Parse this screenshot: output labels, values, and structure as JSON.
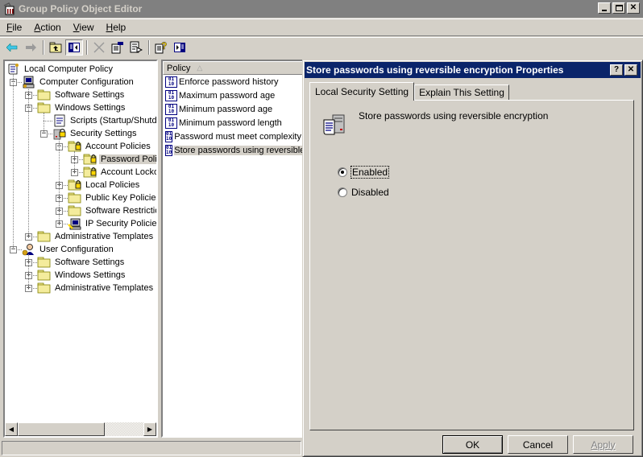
{
  "window": {
    "title": "Group Policy Object Editor",
    "controls": [
      "minimize",
      "maximize",
      "close"
    ]
  },
  "menu": [
    {
      "label": "File",
      "accel": "F"
    },
    {
      "label": "Action",
      "accel": "A"
    },
    {
      "label": "View",
      "accel": "V"
    },
    {
      "label": "Help",
      "accel": "H"
    }
  ],
  "toolbar": [
    "back-icon",
    "forward-icon",
    "up-folder-icon",
    "show-hide-tree-icon",
    "delete-icon",
    "properties-icon",
    "export-list-icon",
    "help-icon",
    "show-hide-action-pane-icon"
  ],
  "tree": {
    "items": [
      {
        "label": "Local Computer Policy",
        "level": 0,
        "icon": "policy-scroll-icon",
        "expander": "none"
      },
      {
        "label": "Computer Configuration",
        "level": 1,
        "icon": "computer-icon",
        "expander": "minus"
      },
      {
        "label": "Software Settings",
        "level": 2,
        "icon": "folder-icon",
        "expander": "plus"
      },
      {
        "label": "Windows Settings",
        "level": 2,
        "icon": "folder-icon",
        "expander": "minus"
      },
      {
        "label": "Scripts (Startup/Shutdown)",
        "level": 3,
        "icon": "script-icon",
        "expander": "none"
      },
      {
        "label": "Security Settings",
        "level": 3,
        "icon": "security-settings-icon",
        "expander": "minus"
      },
      {
        "label": "Account Policies",
        "level": 4,
        "icon": "locked-folder-icon",
        "expander": "minus"
      },
      {
        "label": "Password Policy",
        "level": 5,
        "icon": "locked-folder-icon",
        "expander": "plus",
        "selected": true
      },
      {
        "label": "Account Lockout Policy",
        "level": 5,
        "icon": "locked-folder-icon",
        "expander": "plus"
      },
      {
        "label": "Local Policies",
        "level": 4,
        "icon": "locked-folder-icon",
        "expander": "plus"
      },
      {
        "label": "Public Key Policies",
        "level": 4,
        "icon": "folder-icon",
        "expander": "plus"
      },
      {
        "label": "Software Restriction Policies",
        "level": 4,
        "icon": "folder-icon",
        "expander": "plus"
      },
      {
        "label": "IP Security Policies on Local Computer",
        "level": 4,
        "icon": "ip-security-icon",
        "expander": "plus"
      },
      {
        "label": "Administrative Templates",
        "level": 2,
        "icon": "folder-icon",
        "expander": "plus"
      },
      {
        "label": "User Configuration",
        "level": 1,
        "icon": "user-icon",
        "expander": "minus"
      },
      {
        "label": "Software Settings",
        "level": 2,
        "icon": "folder-icon",
        "expander": "plus"
      },
      {
        "label": "Windows Settings",
        "level": 2,
        "icon": "folder-icon",
        "expander": "plus"
      },
      {
        "label": "Administrative Templates",
        "level": 2,
        "icon": "folder-icon",
        "expander": "plus"
      }
    ]
  },
  "list": {
    "column_header": "Policy",
    "sort_indicator": "△",
    "rows": [
      {
        "label": "Enforce password history"
      },
      {
        "label": "Maximum password age"
      },
      {
        "label": "Minimum password age"
      },
      {
        "label": "Minimum password length"
      },
      {
        "label": "Password must meet complexity requirements"
      },
      {
        "label": "Store passwords using reversible encryption",
        "selected": true
      }
    ]
  },
  "dialog": {
    "title": "Store passwords using reversible encryption Properties",
    "tabs": [
      {
        "label": "Local Security Setting",
        "active": true
      },
      {
        "label": "Explain This Setting",
        "active": false
      }
    ],
    "setting_name": "Store passwords using reversible encryption",
    "options": [
      {
        "label": "Enabled",
        "accel": "E",
        "checked": true,
        "focused": true
      },
      {
        "label": "Disabled",
        "accel": "s",
        "checked": false
      }
    ],
    "buttons": {
      "ok": "OK",
      "cancel": "Cancel",
      "apply": "Apply"
    },
    "apply_enabled": false
  }
}
